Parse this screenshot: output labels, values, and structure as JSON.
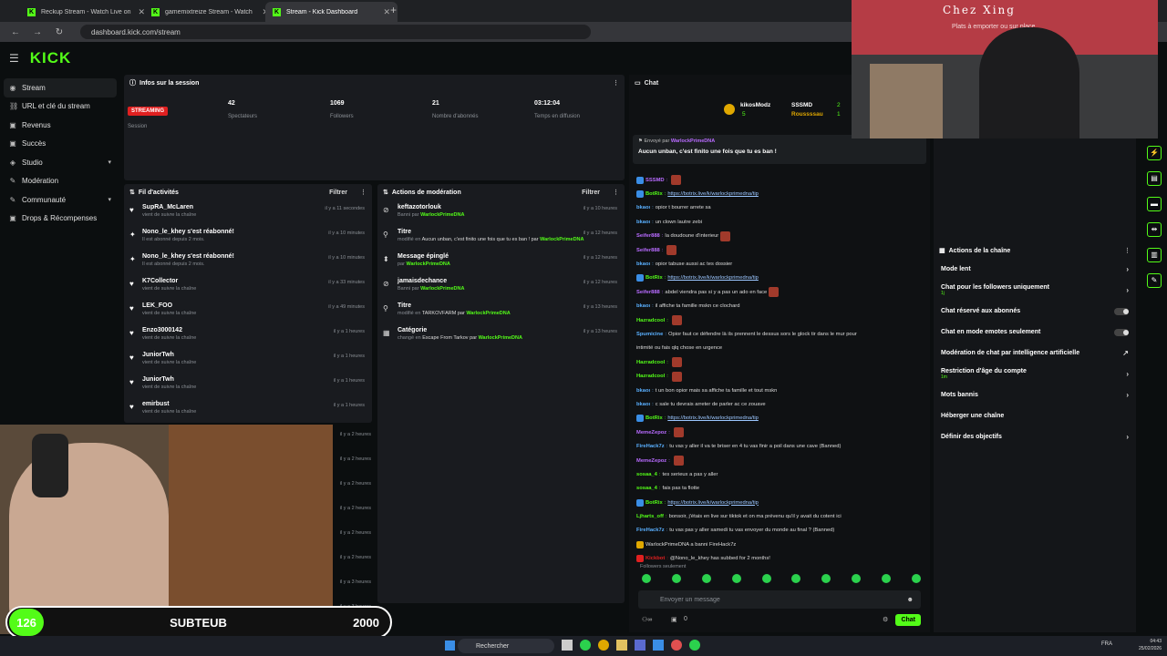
{
  "browser": {
    "tabs": [
      {
        "title": "Reckup Stream - Watch Live on"
      },
      {
        "title": "gamemixtreize Stream - Watch"
      },
      {
        "title": "Stream - Kick Dashboard"
      }
    ],
    "url": "dashboard.kick.com/stream"
  },
  "brand": {
    "logo": "KICK",
    "accent": "#53fc18"
  },
  "sidebar": {
    "items": [
      {
        "label": "Stream",
        "icon": "broadcast-icon"
      },
      {
        "label": "URL et clé du stream",
        "icon": "link-icon"
      },
      {
        "label": "Revenus",
        "icon": "money-icon"
      },
      {
        "label": "Succès",
        "icon": "trophy-icon"
      },
      {
        "label": "Studio",
        "icon": "studio-icon"
      },
      {
        "label": "Modération",
        "icon": "wrench-icon"
      },
      {
        "label": "Communauté",
        "icon": "community-icon"
      },
      {
        "label": "Drops & Récompenses",
        "icon": "gift-icon"
      }
    ]
  },
  "session": {
    "title": "Infos sur la session",
    "badge": "STREAMING",
    "stats": [
      {
        "label": "Session",
        "value": ""
      },
      {
        "label": "Spectateurs",
        "value": "42"
      },
      {
        "label": "Followers",
        "value": "1069"
      },
      {
        "label": "Nombre d'abonnés",
        "value": "21"
      },
      {
        "label": "Temps en diffusion",
        "value": "03:12:04"
      }
    ]
  },
  "feed": {
    "title": "Fil d'activités",
    "filter": "Filtrer",
    "items": [
      {
        "name": "SupRA_McLaren",
        "sub": "vient de suivre la chaîne",
        "time": "il y a 11 secondes"
      },
      {
        "name": "Nono_le_khey s'est réabonné!",
        "sub": "Il est abonné depuis 2 mois.",
        "time": "il y a 10 minutes"
      },
      {
        "name": "Nono_le_khey s'est réabonné!",
        "sub": "Il est abonné depuis 2 mois.",
        "time": "il y a 10 minutes"
      },
      {
        "name": "K7Collector",
        "sub": "vient de suivre la chaîne",
        "time": "il y a 33 minutes"
      },
      {
        "name": "LEK_FOO",
        "sub": "vient de suivre la chaîne",
        "time": "il y a 49 minutes"
      },
      {
        "name": "Enzo3000142",
        "sub": "vient de suivre la chaîne",
        "time": "il y a 1 heures"
      },
      {
        "name": "JuniorTwh",
        "sub": "vient de suivre la chaîne",
        "time": "il y a 1 heures"
      },
      {
        "name": "JuniorTwh",
        "sub": "vient de suivre la chaîne",
        "time": "il y a 1 heures"
      },
      {
        "name": "emirbust",
        "sub": "vient de suivre la chaîne",
        "time": "il y a 1 heures"
      }
    ],
    "hidden_times": [
      "il y a 2 heures",
      "il y a 2 heures",
      "il y a 2 heures",
      "il y a 2 heures",
      "il y a 2 heures",
      "il y a 2 heures",
      "il y a 3 heures",
      "il y a 3 heures"
    ]
  },
  "moderation": {
    "title": "Actions de modération",
    "filter": "Filtrer",
    "items": [
      {
        "title": "keftazotorlouk",
        "prefix": "Banni par ",
        "tail": "",
        "by": "WarlockPrimeDNA",
        "time": "il y a 10 heures",
        "icon": "ban-icon"
      },
      {
        "title": "Titre",
        "prefix": "modifié en ",
        "tail": "Aucun unban, c'est finito une fois que tu es ban ! par ",
        "by": "WarlockPrimeDNA",
        "time": "il y a 12 heures",
        "icon": "title-icon"
      },
      {
        "title": "Message épinglé",
        "prefix": "par ",
        "tail": "",
        "by": "WarlockPrimeDNA",
        "time": "il y a 12 heures",
        "icon": "pin-icon"
      },
      {
        "title": "jamaisdechance",
        "prefix": "Banni par ",
        "tail": "",
        "by": "WarlockPrimeDNA",
        "time": "il y a 12 heures",
        "icon": "ban-icon"
      },
      {
        "title": "Titre",
        "prefix": "modifié en ",
        "tail": "TARKOVFARM par ",
        "by": "WarlockPrimeDNA",
        "time": "il y a 13 heures",
        "icon": "title-icon"
      },
      {
        "title": "Catégorie",
        "prefix": "changé en ",
        "tail": "Escape From Tarkov par ",
        "by": "WarlockPrimeDNA",
        "time": "il y a 13 heures",
        "icon": "category-icon"
      }
    ]
  },
  "chat": {
    "title": "Chat",
    "gifter1": "kikosModz",
    "gifter1_count": "5",
    "gifter2": "SSSMD",
    "gifter2_count": "2",
    "gifter3": "Roussssau",
    "gifter3_count": "1",
    "pinned_by_label": "Envoyé par",
    "pinned_by": "WarlockPrimeDNA",
    "pinned_text": "Aucun unban, c'est finito une fois que tu es ban !",
    "messages": [
      {
        "user": "SSSMD",
        "text": "",
        "color": "#b86bff",
        "link": false,
        "emote": true,
        "badge": true
      },
      {
        "user": "BotRix",
        "text": "https://botrix.live/k/warlockprimedna/tip",
        "color": "#53fc18",
        "link": true,
        "emote": false,
        "badge": true
      },
      {
        "user": "bkaoı",
        "text": "opior t bourrer arrete sa",
        "color": "#5ab0ff",
        "link": false,
        "emote": false,
        "badge": false
      },
      {
        "user": "bkaoı",
        "text": "un clown lautre zebi",
        "color": "#5ab0ff",
        "link": false,
        "emote": false,
        "badge": false
      },
      {
        "user": "Seifer888",
        "text": "la doudoune d'interieur",
        "color": "#b86bff",
        "link": false,
        "emote": true,
        "badge": false
      },
      {
        "user": "Seifer888",
        "text": "",
        "color": "#b86bff",
        "link": false,
        "emote": true,
        "badge": false
      },
      {
        "user": "bkaoı",
        "text": "opior tabuse aussi ac tes dossier",
        "color": "#5ab0ff",
        "link": false,
        "emote": false,
        "badge": false
      },
      {
        "user": "BotRix",
        "text": "https://botrix.live/k/warlockprimedna/tip",
        "color": "#53fc18",
        "link": true,
        "emote": false,
        "badge": true
      },
      {
        "user": "Seifer888",
        "text": "abdel viendra pas si y a pas un ado en face",
        "color": "#b86bff",
        "link": false,
        "emote": true,
        "badge": false
      },
      {
        "user": "bkaoı",
        "text": "il affiche ta famille mskn ce clochard",
        "color": "#5ab0ff",
        "link": false,
        "emote": false,
        "badge": false
      },
      {
        "user": "Hazradcool",
        "text": "",
        "color": "#53fc18",
        "link": false,
        "emote": true,
        "badge": false
      },
      {
        "user": "Spumicine",
        "text": "Opior faut ce défendre là ils prennent le dessus sors le glock tir dans le mur pour",
        "color": "#5ab0ff",
        "link": false,
        "emote": false,
        "badge": false
      },
      {
        "user": "",
        "text": "intimité ou fais qlq chose en urgence",
        "color": "#ddd",
        "link": false,
        "emote": false,
        "badge": false
      },
      {
        "user": "Hazradcool",
        "text": "",
        "color": "#53fc18",
        "link": false,
        "emote": true,
        "badge": false
      },
      {
        "user": "Hazradcool",
        "text": "",
        "color": "#53fc18",
        "link": false,
        "emote": true,
        "badge": false
      },
      {
        "user": "bkaoı",
        "text": "t un bon opior mais sa affiche ta famille et tout mskn",
        "color": "#5ab0ff",
        "link": false,
        "emote": false,
        "badge": false
      },
      {
        "user": "bkaoı",
        "text": "c sale tu devrais arreter de parler ac ce zouave",
        "color": "#5ab0ff",
        "link": false,
        "emote": false,
        "badge": false
      },
      {
        "user": "BotRix",
        "text": "https://botrix.live/k/warlockprimedna/tip",
        "color": "#53fc18",
        "link": true,
        "emote": false,
        "badge": true
      },
      {
        "user": "MemeZepoz",
        "text": "",
        "color": "#b86bff",
        "link": false,
        "emote": true,
        "badge": false
      },
      {
        "user": "FireHack7z",
        "text": "tu vas y aller il va te briser en 4 tu vas finir a poil dans une cave (Banned)",
        "color": "#5ab0ff",
        "link": false,
        "emote": false,
        "badge": false
      },
      {
        "user": "MemeZepoz",
        "text": "",
        "color": "#b86bff",
        "link": false,
        "emote": true,
        "badge": false
      },
      {
        "user": "sosaa_4",
        "text": "tes serieux a pas y aller",
        "color": "#53fc18",
        "link": false,
        "emote": false,
        "badge": false
      },
      {
        "user": "sosaa_4",
        "text": "fais pas ta flotte",
        "color": "#53fc18",
        "link": false,
        "emote": false,
        "badge": false
      },
      {
        "user": "BotRix",
        "text": "https://botrix.live/k/warlockprimedna/tip",
        "color": "#53fc18",
        "link": true,
        "emote": false,
        "badge": true
      },
      {
        "user": "Ljharts_off",
        "text": "bonsoir, j'étais en live sur tiktok et on ma prévenu qu'il y avait du cotent ici",
        "color": "#53fc18",
        "link": false,
        "emote": false,
        "badge": false
      },
      {
        "user": "FireHack7z",
        "text": "tu vas pas y aller samedi tu vas envoyer du monde au final ? (Banned)",
        "color": "#5ab0ff",
        "link": false,
        "emote": false,
        "badge": false
      },
      {
        "user": "",
        "text": "WarlockPrimeDNA a banni FireHack7z",
        "color": "#ddd",
        "link": false,
        "emote": false,
        "badge": true
      },
      {
        "user": "Kickbot",
        "text": "@Nono_le_khey has subbed for 2 months!",
        "color": "#e02020",
        "link": false,
        "emote": false,
        "badge": true
      }
    ],
    "followers_only": "Followers seulement",
    "placeholder": "Envoyer un message",
    "viewers_icon_count": "",
    "counter": "0",
    "send_label": "Chat"
  },
  "channel_actions": {
    "title": "Actions de la chaîne",
    "items": [
      {
        "label": "Mode lent",
        "sub": "",
        "control": "chevron"
      },
      {
        "label": "Chat pour les followers uniquement",
        "sub": "1j",
        "control": "chevron"
      },
      {
        "label": "Chat réservé aux abonnés",
        "sub": "",
        "control": "toggle"
      },
      {
        "label": "Chat en mode emotes seulement",
        "sub": "",
        "control": "toggle"
      },
      {
        "label": "Modération de chat par intelligence artificielle",
        "sub": "",
        "control": "external"
      },
      {
        "label": "Restriction d'âge du compte",
        "sub": "1m",
        "control": "chevron"
      },
      {
        "label": "Mots bannis",
        "sub": "",
        "control": "chevron"
      },
      {
        "label": "Héberger une chaîne",
        "sub": "",
        "control": "none"
      },
      {
        "label": "Définir des objectifs",
        "sub": "",
        "control": "chevron"
      }
    ]
  },
  "webcam_overlay": {
    "shop_sign": "Chez Xing",
    "shop_sub": "Plats à emporter ou sur place"
  },
  "goal": {
    "count": "126",
    "name": "SUBTEUB",
    "target": "2000"
  },
  "taskbar": {
    "search": "Rechercher",
    "time": "04:43",
    "date": "25/02/2026",
    "lang": "FRA"
  }
}
